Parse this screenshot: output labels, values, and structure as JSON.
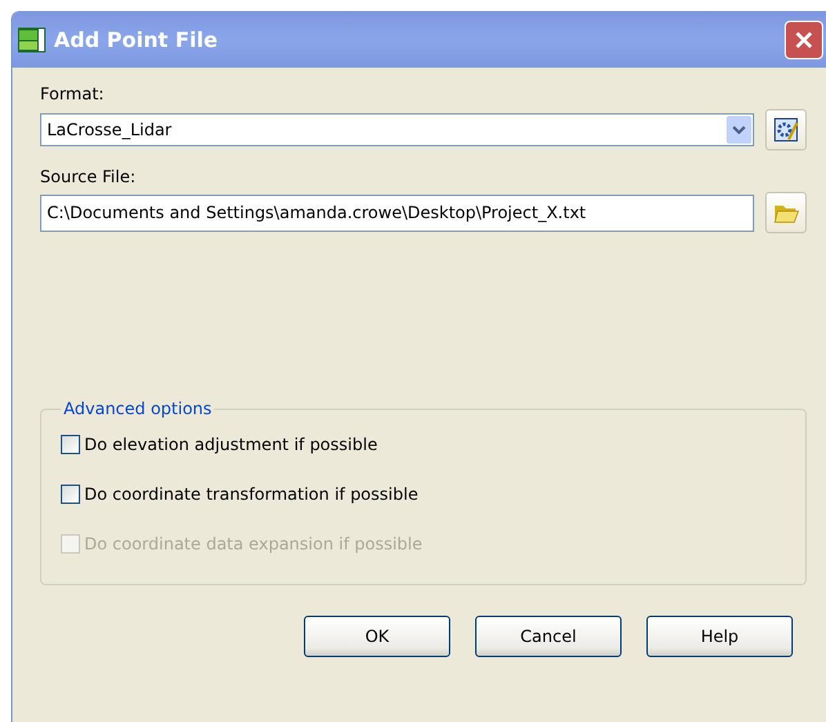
{
  "window": {
    "title": "Add Point File"
  },
  "format": {
    "label": "Format:",
    "value": "LaCrosse_Lidar"
  },
  "source_file": {
    "label": "Source File:",
    "value": "C:\\Documents and Settings\\amanda.crowe\\Desktop\\Project_X.txt"
  },
  "advanced_options": {
    "title": "Advanced options",
    "options": [
      {
        "label": "Do elevation adjustment if possible",
        "checked": false,
        "disabled": false
      },
      {
        "label": "Do coordinate transformation if possible",
        "checked": false,
        "disabled": false
      },
      {
        "label": "Do coordinate data expansion if possible",
        "checked": false,
        "disabled": true
      }
    ]
  },
  "buttons": [
    "OK",
    "Cancel",
    "Help"
  ]
}
